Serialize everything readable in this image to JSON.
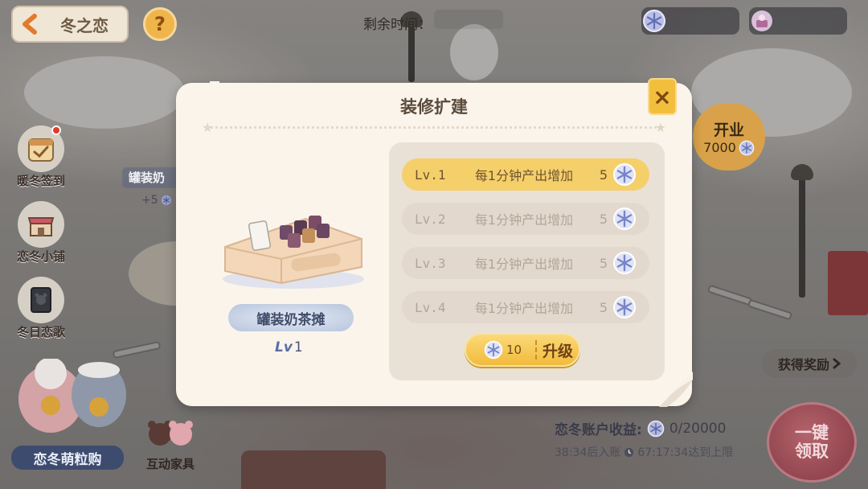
{
  "header": {
    "back_title": "冬之恋",
    "help_label": "?",
    "timer_label": "剩余时间："
  },
  "left_menu": [
    {
      "label": "暖冬签到",
      "icon": "calendar-check-icon",
      "has_badge": true
    },
    {
      "label": "恋冬小铺",
      "icon": "shop-icon",
      "has_badge": false
    },
    {
      "label": "冬日恋歌",
      "icon": "music-book-icon",
      "has_badge": false
    }
  ],
  "bottom": {
    "meng_label": "恋冬萌粒购",
    "hudong_label": "互动家具",
    "reward_link": "获得奖励",
    "account_label": "恋冬账户收益:",
    "account_value": "0/20000",
    "account_sub_time": "38:34后入账",
    "account_sub_limit": "67:17:34达到上限",
    "claim_line1": "一键",
    "claim_line2": "领取"
  },
  "open_badge": {
    "title": "开业",
    "value": "7000"
  },
  "background_label": {
    "name": "罐装奶",
    "plus": "+5"
  },
  "dialog": {
    "title": "装修扩建",
    "close_label": "×",
    "item_name": "罐装奶茶摊",
    "item_level_tag": "Lv",
    "item_level": "1",
    "levels": [
      {
        "name": "Lv.1",
        "desc": "每1分钟产出增加",
        "value": "5",
        "active": true
      },
      {
        "name": "Lv.2",
        "desc": "每1分钟产出增加",
        "value": "5",
        "active": false
      },
      {
        "name": "Lv.3",
        "desc": "每1分钟产出增加",
        "value": "5",
        "active": false
      },
      {
        "name": "Lv.4",
        "desc": "每1分钟产出增加",
        "value": "5",
        "active": false
      }
    ],
    "upgrade_cost": "10",
    "upgrade_label": "升级"
  },
  "colors": {
    "accent_gold": "#f2bb3c",
    "active_row": "#f5cf6a",
    "snowflake": "#8a95d6",
    "claim_red": "#934650"
  }
}
